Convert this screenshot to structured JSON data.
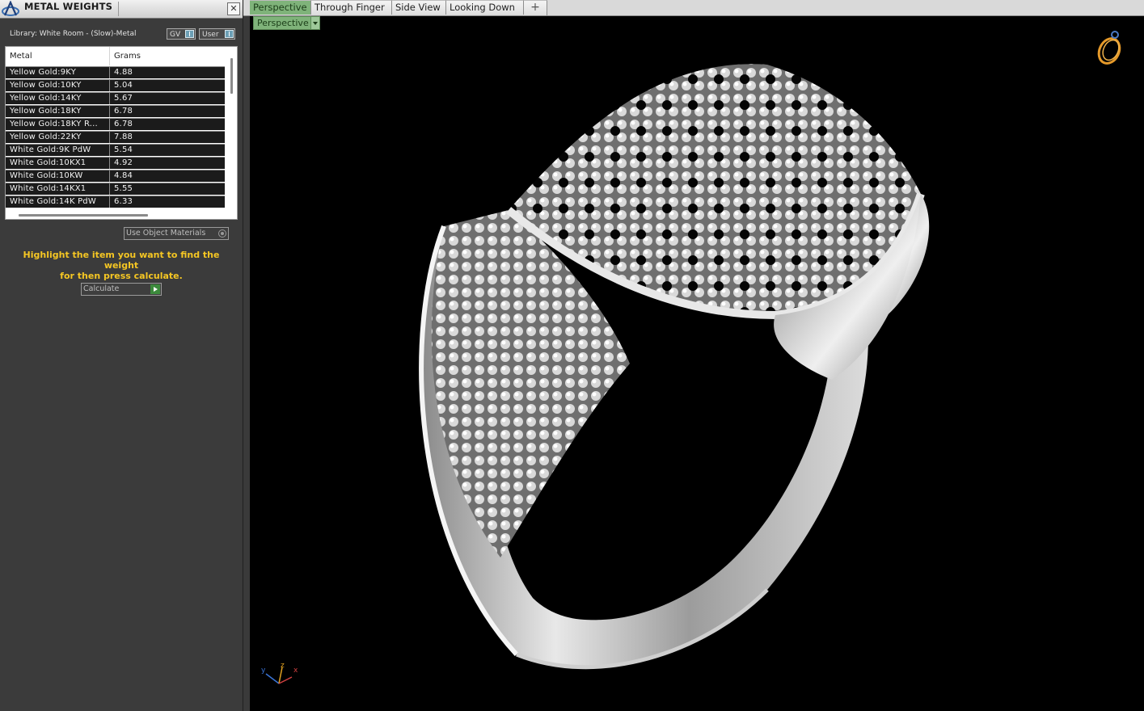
{
  "panel": {
    "title": "METAL WEIGHTS",
    "close_glyph": "✕",
    "library_label": "Library: White Room - (Slow)-Metal",
    "toggle_gv": "GV",
    "toggle_user": "User",
    "table": {
      "headers": [
        "Metal",
        "Grams"
      ],
      "rows": [
        {
          "metal": "Yellow Gold:9KY",
          "grams": "4.88"
        },
        {
          "metal": "Yellow Gold:10KY",
          "grams": "5.04"
        },
        {
          "metal": "Yellow Gold:14KY",
          "grams": "5.67"
        },
        {
          "metal": "Yellow Gold:18KY",
          "grams": "6.78"
        },
        {
          "metal": "Yellow Gold:18KY R...",
          "grams": "6.78"
        },
        {
          "metal": "Yellow Gold:22KY",
          "grams": "7.88"
        },
        {
          "metal": "White Gold:9K PdW",
          "grams": "5.54"
        },
        {
          "metal": "White Gold:10KX1",
          "grams": "4.92"
        },
        {
          "metal": "White Gold:10KW",
          "grams": "4.84"
        },
        {
          "metal": "White Gold:14KX1",
          "grams": "5.55"
        },
        {
          "metal": "White Gold:14K PdW",
          "grams": "6.33"
        }
      ]
    },
    "use_object_materials": "Use Object Materials",
    "hint_line1": "Highlight the item you want to find the weight",
    "hint_line2": "for then press calculate.",
    "calculate_label": "Calculate",
    "hint_color": "#f5c623"
  },
  "tabs": {
    "items": [
      "Perspective",
      "Through Finger",
      "Side View",
      "Looking Down"
    ],
    "active": "Perspective",
    "add_glyph": "+"
  },
  "viewport": {
    "view_dropdown": "Perspective",
    "axis_labels": {
      "x": "x",
      "y": "y",
      "z": "z"
    },
    "active_color": "#7fb37a",
    "background": "#000000"
  }
}
